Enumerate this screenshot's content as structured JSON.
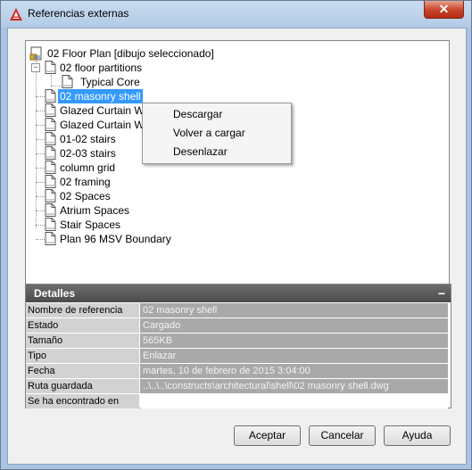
{
  "window": {
    "title": "Referencias externas",
    "close_label": "✕"
  },
  "tree": {
    "root": "02 Floor Plan [dibujo seleccionado]",
    "nodes": [
      "02 floor partitions",
      "Typical Core",
      "02 masonry shell",
      "Glazed Curtain Wa",
      "Glazed Curtain Wa",
      "01-02 stairs",
      "02-03 stairs",
      "column grid",
      "02 framing",
      "02 Spaces",
      "Atrium Spaces",
      "Stair Spaces",
      "Plan 96 MSV Boundary"
    ],
    "expander_symbol": "−"
  },
  "context_menu": {
    "items": [
      "Descargar",
      "Volver a cargar",
      "Desenlazar"
    ]
  },
  "details": {
    "title": "Detalles",
    "collapse_symbol": "−",
    "rows": [
      {
        "key": "Nombre de referencia",
        "value": "02 masonry shell"
      },
      {
        "key": "Estado",
        "value": "Cargado"
      },
      {
        "key": "Tamaño",
        "value": "565KB"
      },
      {
        "key": "Tipo",
        "value": "Enlazar"
      },
      {
        "key": "Fecha",
        "value": "martes, 10 de febrero de 2015  3:04:00"
      },
      {
        "key": "Ruta guardada",
        "value": "..\\..\\..\\constructs\\architectural\\shell\\02 masonry shell.dwg"
      },
      {
        "key": "Se ha encontrado en",
        "value": ""
      }
    ]
  },
  "buttons": {
    "accept": "Aceptar",
    "cancel": "Cancelar",
    "help": "Ayuda"
  }
}
